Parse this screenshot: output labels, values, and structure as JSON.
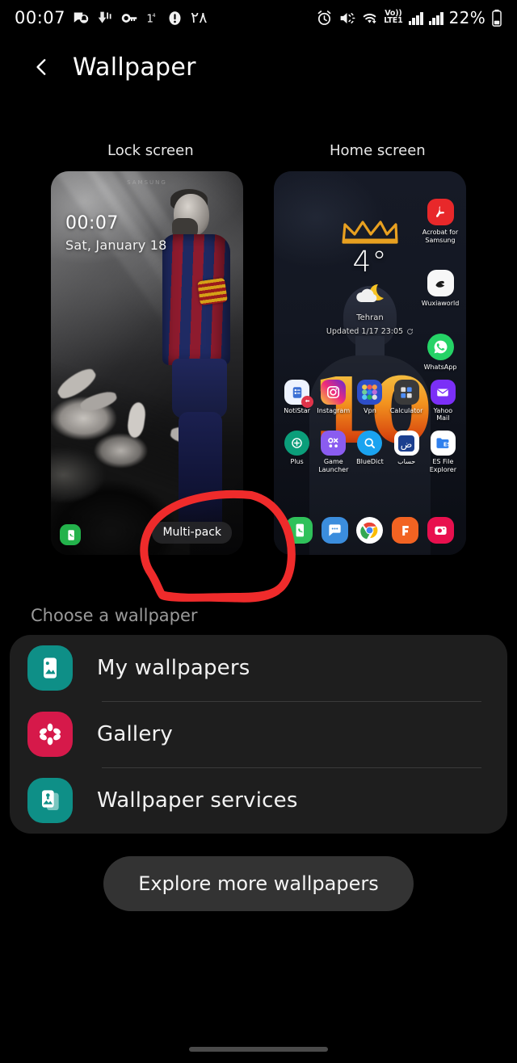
{
  "status_bar": {
    "clock": "00:07",
    "temperature": "1",
    "temperature_sup": "4",
    "notification_count": "٢٨",
    "network_label_top": "Vo))",
    "network_label_bottom": "LTE1",
    "battery_percent": "22%",
    "icons": [
      "notification-icon",
      "vibrate-down-icon",
      "key-icon",
      "thermometer-icon",
      "alert-icon",
      "alarm-icon",
      "mute-icon",
      "wifi-icon",
      "signal-bars-icon",
      "signal-bars-2-icon",
      "battery-icon"
    ]
  },
  "header": {
    "back_icon": "chevron-left-icon",
    "title": "Wallpaper"
  },
  "previews": {
    "lock_label": "Lock screen",
    "home_label": "Home screen",
    "lock": {
      "watermark": "SAMSUNG",
      "time": "00:07",
      "date": "Sat, January 18",
      "badge": "Multi-pack",
      "shortcut_icon": "phone-icon"
    },
    "home": {
      "temperature": "4°",
      "city": "Tehran",
      "updated": "Updated 1/17 23:05",
      "big_number": "10",
      "apps_row1": [
        {
          "label": "NotiStar",
          "icon": "notistar-icon",
          "color": "#f4f7ff",
          "badge": true
        },
        {
          "label": "Instagram",
          "icon": "instagram-icon",
          "color": "#d62976"
        },
        {
          "label": "Vpn",
          "icon": "vpn-folder-icon",
          "color": "#2d4ec8"
        },
        {
          "label": "Calculator",
          "icon": "calculator-icon",
          "color": "#3a3a3a"
        },
        {
          "label": "Yahoo Mail",
          "icon": "yahoo-mail-icon",
          "color": "#7b2ff7"
        }
      ],
      "apps_row2": [
        {
          "label": "Plus",
          "icon": "plus-chat-icon",
          "color": "#0b9e7a"
        },
        {
          "label": "Game Launcher",
          "icon": "game-launcher-icon",
          "color": "#8a5cf0"
        },
        {
          "label": "BlueDict",
          "icon": "bluedict-icon",
          "color": "#1aa3f0"
        },
        {
          "label": "حساب",
          "icon": "arabic-app-icon",
          "color": "#1c3f8f"
        },
        {
          "label": "ES File Explorer",
          "icon": "es-file-explorer-icon",
          "color": "#ffffff"
        }
      ],
      "right_apps": [
        {
          "label": "Acrobat for Samsung",
          "icon": "acrobat-icon",
          "color": "#e8282a"
        },
        {
          "label": "Wuxiaworld",
          "icon": "wuxiaworld-icon",
          "color": "#ffffff"
        },
        {
          "label": "WhatsApp",
          "icon": "whatsapp-icon",
          "color": "#25d366"
        }
      ],
      "dock": [
        {
          "icon": "phone-icon",
          "color": "#2fc15a"
        },
        {
          "icon": "messages-icon",
          "color": "#3b8ddd"
        },
        {
          "icon": "chrome-icon",
          "color": "#ffffff"
        },
        {
          "icon": "orange-app-icon",
          "color": "#f26322"
        },
        {
          "icon": "camera-app-icon",
          "color": "#e8104e"
        }
      ]
    }
  },
  "annotation": {
    "shape": "hand-drawn-circle",
    "color": "#ef2b2b"
  },
  "choose_section": {
    "title": "Choose a wallpaper",
    "items": [
      {
        "label": "My wallpapers",
        "icon": "my-wallpapers-icon",
        "color": "#0e8f87"
      },
      {
        "label": "Gallery",
        "icon": "gallery-flower-icon",
        "color": "#d6194a"
      },
      {
        "label": "Wallpaper services",
        "icon": "wallpaper-services-icon",
        "color": "#0e8f87"
      }
    ]
  },
  "explore": {
    "label": "Explore more wallpapers"
  },
  "colors": {
    "background": "#000000",
    "card": "#1e1e1e",
    "button": "#333333",
    "teal": "#0e8f87",
    "pink": "#d6194a",
    "annotation_red": "#ef2b2b"
  }
}
